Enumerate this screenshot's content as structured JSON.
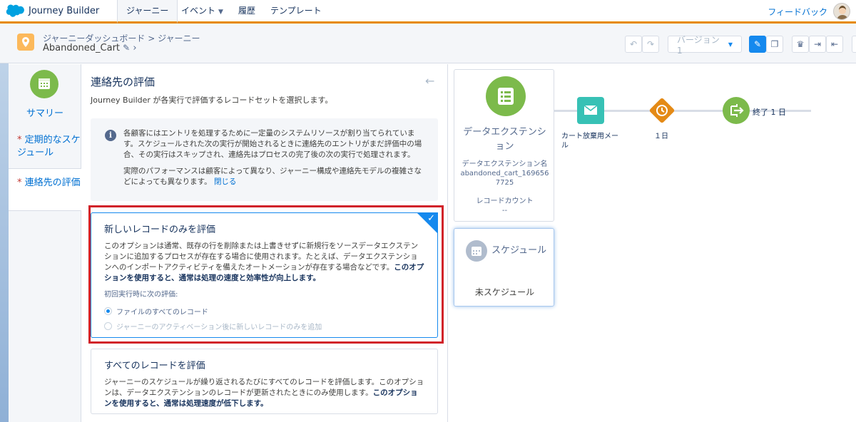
{
  "app": {
    "name": "Journey Builder",
    "feedback": "フィードバック"
  },
  "nav": {
    "tabs": [
      {
        "label": "ジャーニー",
        "active": true
      },
      {
        "label": "イベント",
        "dropdown": true
      },
      {
        "label": "履歴"
      },
      {
        "label": "テンプレート"
      }
    ]
  },
  "header": {
    "breadcrumb": "ジャーニーダッシュボード > ジャーニー",
    "journey_name": "Abandoned_Cart",
    "version": "バージョン 1"
  },
  "sidebar": {
    "summary": "サマリー",
    "items": [
      {
        "required": "*",
        "label": "定期的なスケジュール"
      },
      {
        "required": "*",
        "label": "連絡先の評価"
      }
    ]
  },
  "panel": {
    "title": "連絡先の評価",
    "description": "Journey Builder が各実行で評価するレコードセットを選択します。",
    "info_para1": "各顧客にはエントリを処理するために一定量のシステムリソースが割り当てられています。スケジュールされた次の実行が開始されるときに連絡先のエントリがまだ評価中の場合、その実行はスキップされ、連絡先はプロセスの完了後の次の実行で処理されます。",
    "info_para2": "実際のパフォーマンスは顧客によって異なり、ジャーニー構成や連絡先モデルの複雑さなどによっても異なります。",
    "info_close": "閉じる",
    "option1": {
      "title": "新しいレコードのみを評価",
      "body": "このオプションは通常、既存の行を削除または上書きせずに新規行をソースデータエクステンションに追加するプロセスが存在する場合に使用されます。たとえば、データエクステンションへのインポートアクティビティを備えたオートメーションが存在する場合などです。",
      "body_bold": "このオプションを使用すると、通常は処理の速度と効率性が向上します。",
      "sub_label": "初回実行時に次の評価:",
      "radio1": "ファイルのすべてのレコード",
      "radio2": "ジャーニーのアクティベーション後に新しいレコードのみを追加"
    },
    "option2": {
      "title": "すべてのレコードを評価",
      "body": "ジャーニーのスケジュールが繰り返されるたびにすべてのレコードを評価します。このオプションは、データエクステンションのレコードが更新されたときにのみ使用します。",
      "body_bold": "このオプションを使用すると、通常は処理速度が低下します。"
    }
  },
  "canvas": {
    "entry": {
      "title": "データエクステンション",
      "de_label": "データエクステンション名",
      "de_value": "abandoned_cart_1696567725",
      "count_label": "レコードカウント",
      "count_value": "--"
    },
    "schedule": {
      "title": "スケジュール",
      "status": "未スケジュール"
    },
    "nodes": {
      "email": "カート放棄用メール",
      "wait": "１日",
      "exit": "終了 1 日"
    }
  }
}
